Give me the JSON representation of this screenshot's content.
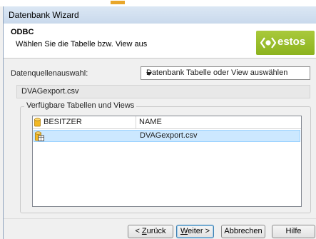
{
  "window": {
    "title": "Datenbank Wizard"
  },
  "header": {
    "heading": "ODBC",
    "subheading": "Wählen Sie die Tabelle bzw. View aus",
    "logo_text": "estos",
    "brand_color": "#9cbf2b"
  },
  "source": {
    "label": "Datenquellenauswahl:",
    "selected_option": "Datenbank Tabelle oder View auswählen",
    "selected_file": "DVAGexport.csv"
  },
  "tables": {
    "group_label": "Verfügbare Tabellen und Views",
    "columns": [
      "BESITZER",
      "NAME"
    ],
    "rows": [
      {
        "owner": "",
        "name": "DVAGexport.csv",
        "selected": true
      }
    ]
  },
  "buttons": {
    "back": {
      "prefix": "< ",
      "accel": "Z",
      "rest": "urück"
    },
    "next": {
      "accel": "W",
      "rest": "eiter >"
    },
    "cancel": "Abbrechen",
    "help": "Hilfe"
  }
}
